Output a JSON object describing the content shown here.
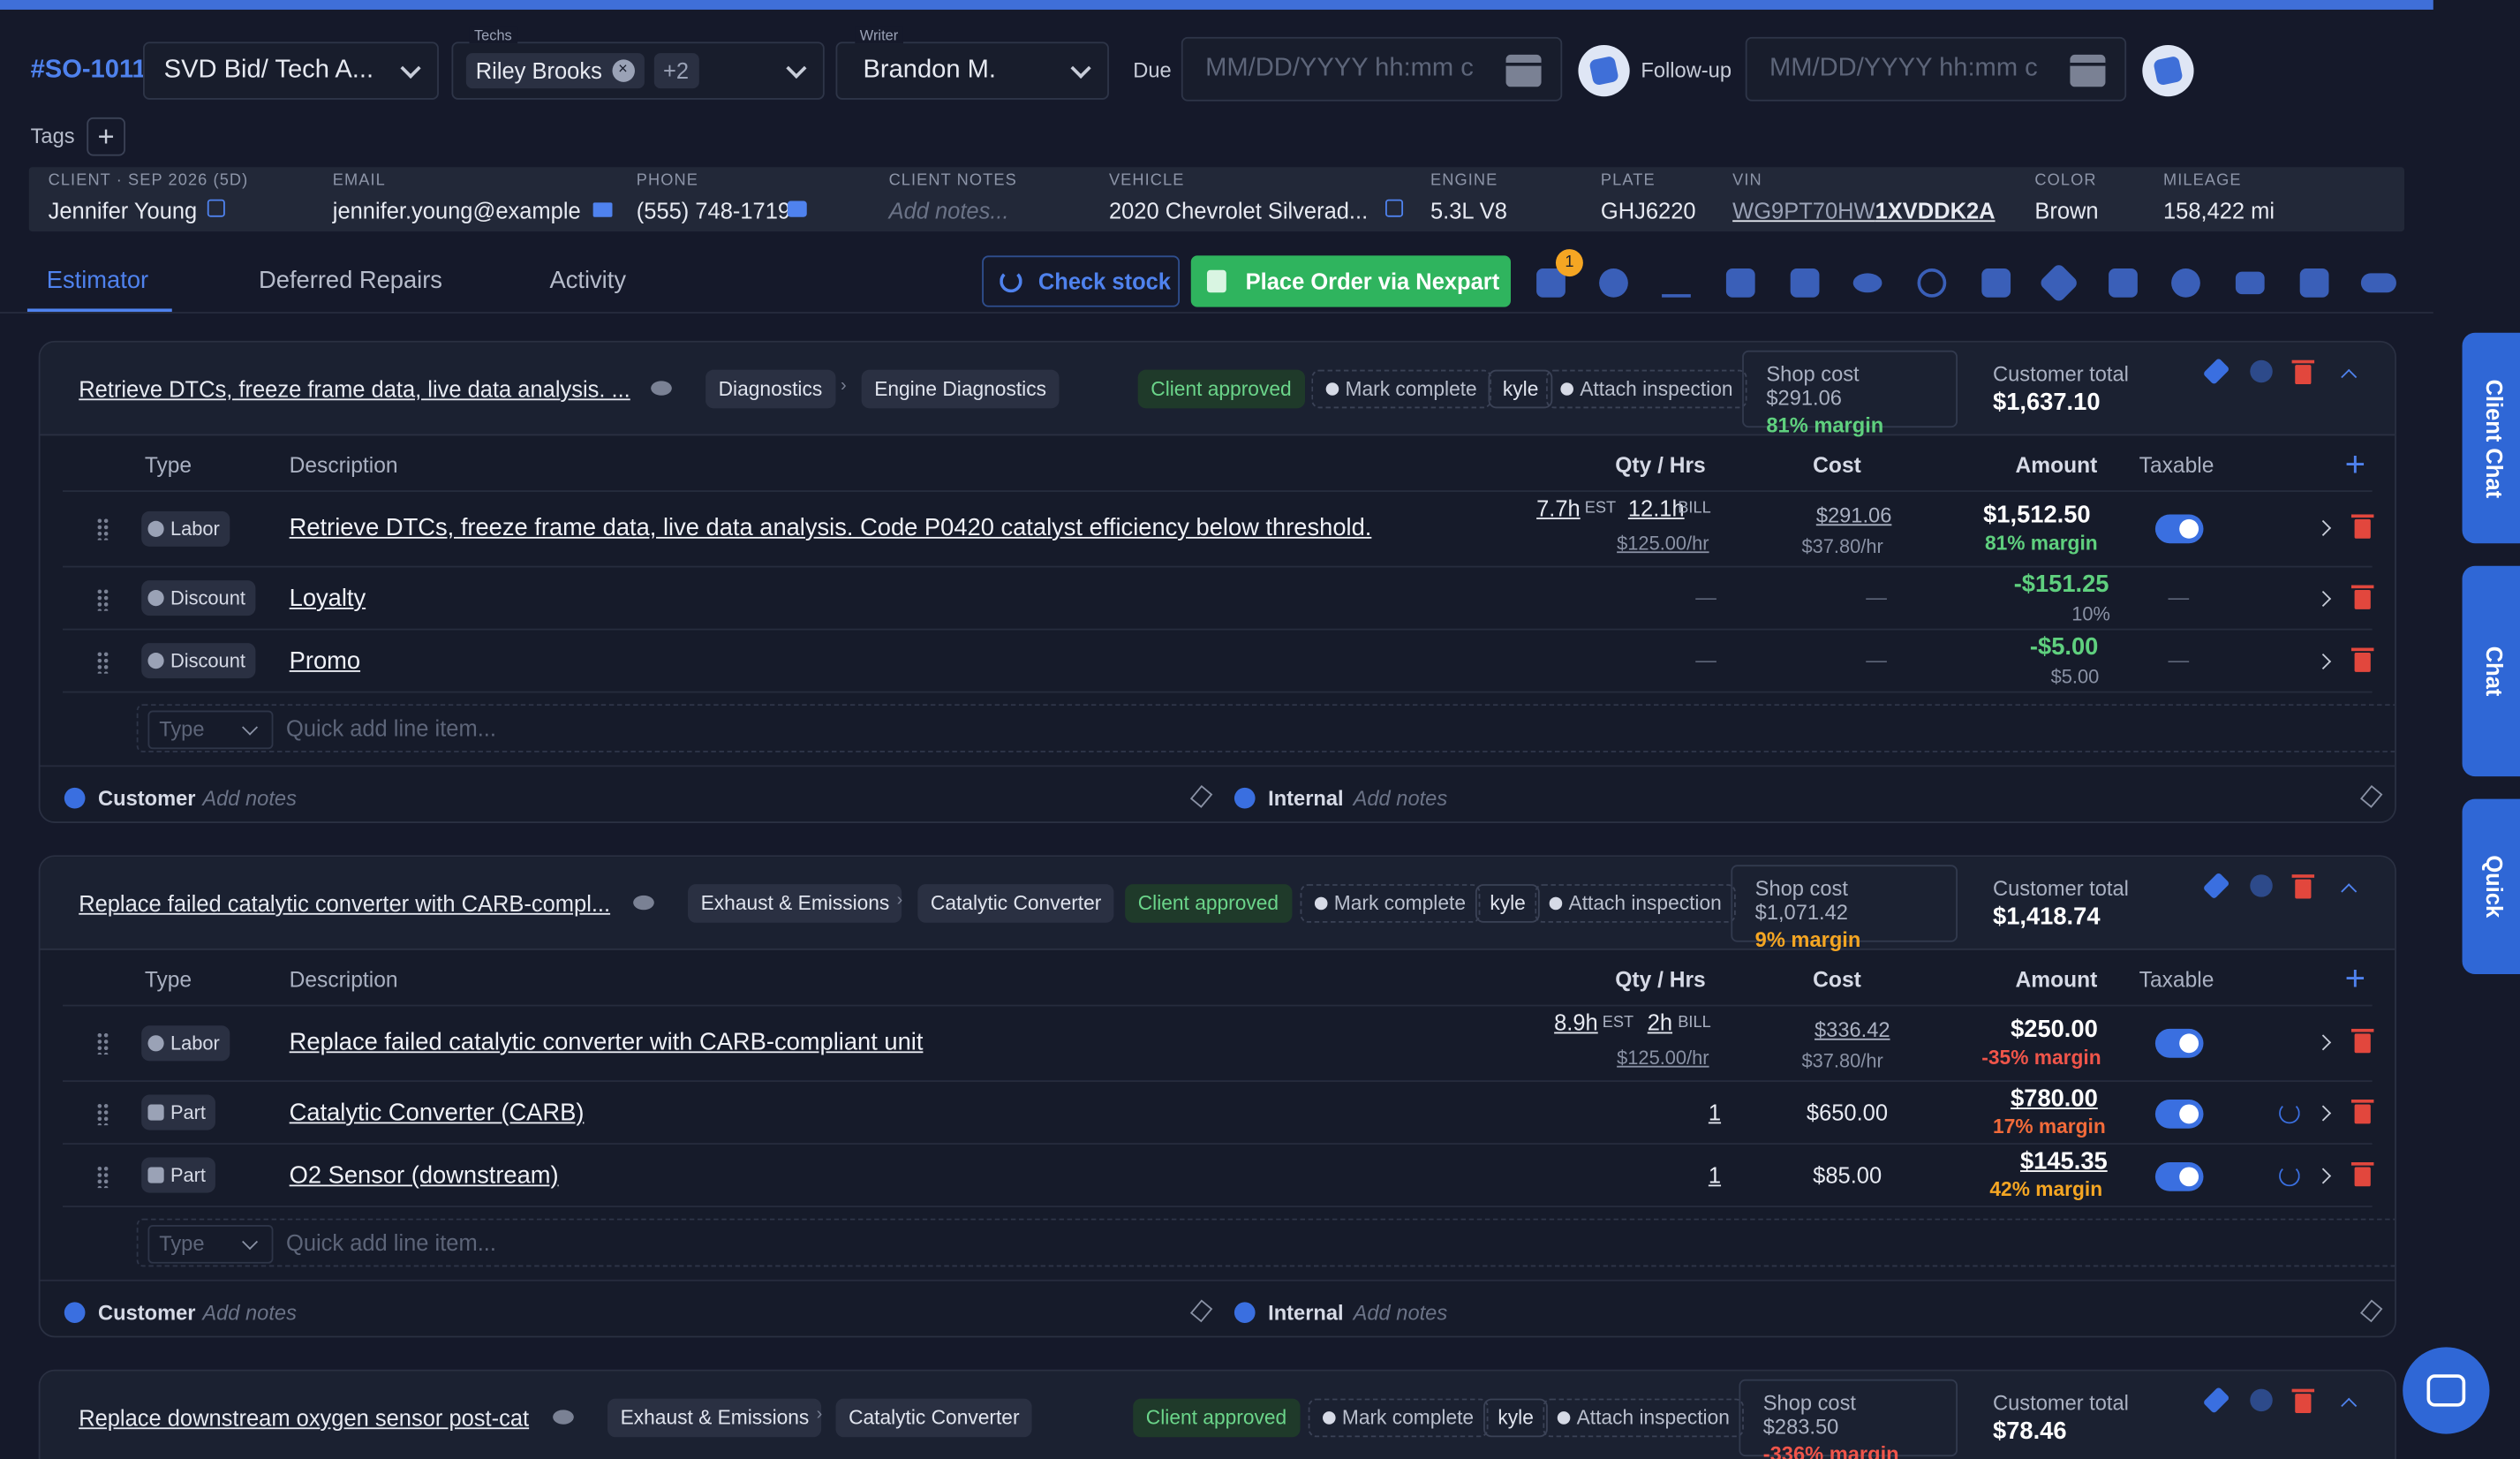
{
  "header": {
    "order_id": "#SO-1011",
    "job_select": "SVD Bid/ Tech A...",
    "techs_label": "Techs",
    "tech_name": "Riley Brooks",
    "tech_more": "+2",
    "writer_label": "Writer",
    "writer_name": "Brandon M.",
    "due_label": "Due",
    "due_placeholder": "MM/DD/YYYY hh:mm c",
    "followup_label": "Follow-up",
    "followup_placeholder": "MM/DD/YYYY hh:mm c",
    "tags_label": "Tags"
  },
  "info": {
    "client_label": "CLIENT · SEP 2026 (5D)",
    "client": "Jennifer Young",
    "email_label": "EMAIL",
    "email": "jennifer.young@example",
    "phone_label": "PHONE",
    "phone": "(555) 748-1719",
    "notes_label": "CLIENT NOTES",
    "notes_placeholder": "Add notes...",
    "vehicle_label": "VEHICLE",
    "vehicle": "2020 Chevrolet Silverad...",
    "engine_label": "ENGINE",
    "engine": "5.3L V8",
    "plate_label": "PLATE",
    "plate": "GHJ6220",
    "vin_label": "VIN",
    "vin_a": "WG9PT70HW",
    "vin_b": "1XVDDK2A",
    "color_label": "COLOR",
    "color": "Brown",
    "mileage_label": "MILEAGE",
    "mileage": "158,422 mi"
  },
  "tabs": {
    "estimator": "Estimator",
    "deferred": "Deferred Repairs",
    "activity": "Activity",
    "check_stock": "Check stock",
    "place_order": "Place Order via Nexpart",
    "badge": "1"
  },
  "cols": {
    "type": "Type",
    "description": "Description",
    "qty": "Qty / Hrs",
    "cost": "Cost",
    "amount": "Amount",
    "taxable": "Taxable"
  },
  "common": {
    "client_approved": "Client approved",
    "mark_complete": "Mark complete",
    "user": "kyle",
    "attach": "Attach inspection",
    "customer_total_label": "Customer total",
    "customer": "Customer",
    "internal": "Internal",
    "add_notes": "Add notes",
    "quick_type": "Type",
    "quick_add": "Quick add line item...",
    "dash": "—"
  },
  "job1": {
    "title": "Retrieve DTCs, freeze frame data, live data analysis. ...",
    "cat": "Diagnostics",
    "sub": "Engine Diagnostics",
    "shop_cost": "Shop cost $291.06",
    "margin": "81% margin",
    "total": "$1,637.10",
    "l1_type": "Labor",
    "l1_desc": "Retrieve DTCs, freeze frame data, live data analysis. Code P0420 catalyst efficiency below threshold.",
    "l1_est": "7.7h",
    "l1_est_l": "EST",
    "l1_bill": "12.1h",
    "l1_bill_l": "BILL",
    "l1_rate": "$125.00/hr",
    "l1_cost": "$291.06",
    "l1_cost_rate": "$37.80/hr",
    "l1_amt": "$1,512.50",
    "l1_margin": "81% margin",
    "l2_type": "Discount",
    "l2_desc": "Loyalty",
    "l2_amt": "-$151.25",
    "l2_sub": "10%",
    "l3_type": "Discount",
    "l3_desc": "Promo",
    "l3_amt": "-$5.00",
    "l3_sub": "$5.00"
  },
  "job2": {
    "title": "Replace failed catalytic converter with CARB-compl...",
    "cat": "Exhaust & Emissions",
    "sub": "Catalytic Converter",
    "shop_cost": "Shop cost $1,071.42",
    "margin": "9% margin",
    "total": "$1,418.74",
    "l1_type": "Labor",
    "l1_desc": "Replace failed catalytic converter with CARB-compliant unit",
    "l1_est": "8.9h",
    "l1_est_l": "EST",
    "l1_bill": "2h",
    "l1_bill_l": "BILL",
    "l1_rate": "$125.00/hr",
    "l1_cost": "$336.42",
    "l1_cost_rate": "$37.80/hr",
    "l1_amt": "$250.00",
    "l1_margin": "-35% margin",
    "l2_type": "Part",
    "l2_desc": "Catalytic Converter (CARB)",
    "l2_qty": "1",
    "l2_cost": "$650.00",
    "l2_amt": "$780.00",
    "l2_margin": "17% margin",
    "l3_type": "Part",
    "l3_desc": "O2 Sensor (downstream)",
    "l3_qty": "1",
    "l3_cost": "$85.00",
    "l3_amt": "$145.35",
    "l3_margin": "42% margin"
  },
  "job3": {
    "title": "Replace downstream oxygen sensor post-cat",
    "cat": "Exhaust & Emissions",
    "sub": "Catalytic Converter",
    "shop_cost": "Shop cost $283.50",
    "margin": "-336% margin",
    "total": "$78.46"
  },
  "sidetabs": {
    "client_chat": "Client Chat",
    "chat": "Chat",
    "quick": "Quick"
  }
}
